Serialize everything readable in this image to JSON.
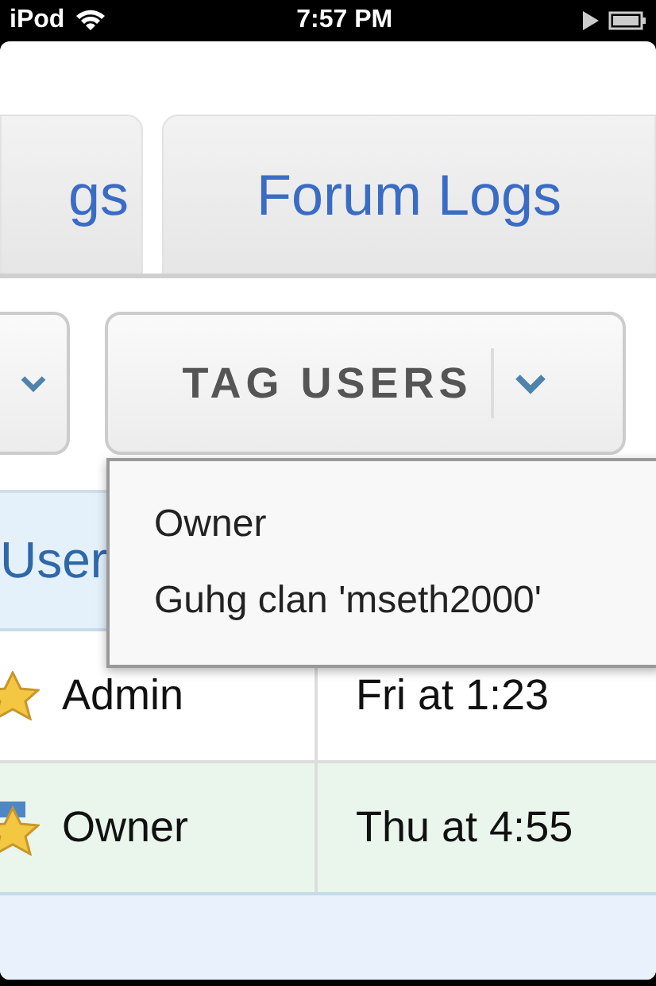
{
  "status_bar": {
    "carrier": "iPod",
    "time": "7:57 PM"
  },
  "tabs": [
    {
      "label": "gs",
      "selected": false
    },
    {
      "label": "Forum Logs",
      "selected": false
    }
  ],
  "buttons": [
    {
      "kind": "dropdown"
    },
    {
      "label": "TAG USERS",
      "kind": "dropdown"
    }
  ],
  "dropdown": {
    "items": [
      "Owner",
      "Guhg clan 'mseth2000'"
    ]
  },
  "table": {
    "header": "User",
    "rows": [
      {
        "kind": "star",
        "user": "Admin",
        "time": "Fri at 1:23",
        "highlighted": false
      },
      {
        "kind": "medal",
        "user": "Owner",
        "time": "Thu at 4:55",
        "highlighted": true
      }
    ]
  }
}
